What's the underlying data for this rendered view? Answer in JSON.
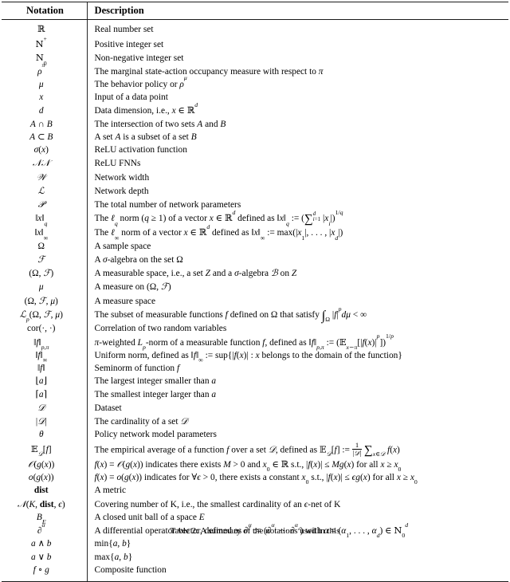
{
  "table": {
    "columns": [
      "Notation",
      "Description"
    ],
    "rows": [
      {
        "notation_html": "<span class=\"bb\">&#8477;</span>",
        "description_html": "Real number set"
      },
      {
        "notation_html": "<span class=\"bb\">N</span><sup>+</sup>",
        "description_html": "Positive integer set"
      },
      {
        "notation_html": "<span class=\"bb\">N</span><sub>0</sub>",
        "description_html": "Non-negative integer set"
      },
      {
        "notation_html": "<span class=\"mi\">&#961;</span><sup><span class=\"mi\">&#960;</span></sup>",
        "description_html": "The marginal state-action occupancy measure with respect to <span class=\"mi\">&#960;</span>"
      },
      {
        "notation_html": "<span class=\"mi\">&#956;</span>",
        "description_html": "The behavior policy or <span class=\"mi\">&#961;</span><sup><span class=\"mi\">&#956;</span></sup>"
      },
      {
        "notation_html": "<span class=\"mi\">x</span>",
        "description_html": "Input of a data point"
      },
      {
        "notation_html": "<span class=\"mi\">d</span>",
        "description_html": "Data dimension, i.e., <span class=\"mi\">x</span> &#8712; <span class=\"bb\">&#8477;</span><sup><span class=\"mi\">d</span></sup>"
      },
      {
        "notation_html": "<span class=\"mi\">A</span> &#8745; <span class=\"mi\">B</span>",
        "description_html": "The intersection of two sets <span class=\"mi\">A</span> and <span class=\"mi\">B</span>"
      },
      {
        "notation_html": "<span class=\"mi\">A</span> &#8834; <span class=\"mi\">B</span>",
        "description_html": "A set <span class=\"mi\">A</span> is a subset of a set <span class=\"mi\">B</span>"
      },
      {
        "notation_html": "<span class=\"mi\">&#963;</span>(<span class=\"mi\">x</span>)",
        "description_html": "ReLU activation function"
      },
      {
        "notation_html": "<span class=\"cal\">&#119977;&#119977;</span>",
        "description_html": "ReLU FNNs"
      },
      {
        "notation_html": "<span class=\"cal\">&#119986;</span>",
        "description_html": "Network width"
      },
      {
        "notation_html": "<span class=\"cal\">&#8466;</span>",
        "description_html": "Network depth"
      },
      {
        "notation_html": "<span class=\"cal\">&#119979;</span>",
        "description_html": "The total number of network parameters"
      },
      {
        "notation_html": "&#8214;<span class=\"mi\">x</span>&#8214;<sub><span class=\"mi\">q</span></sub>",
        "description_html": "The <span class=\"mi\">&#8467;</span><sub><span class=\"mi\">q</span></sub> norm (<span class=\"mi\">q</span> &#8805; 1) of a vector <span class=\"mi\">x</span> &#8712; <span class=\"bb\">&#8477;</span><sup><span class=\"mi\">d</span></sup> defined as &#8214;<span class=\"mi\">x</span>&#8214;<sub><span class=\"mi\">q</span></sub> := (<span class=\"bigop\">&#8721;</span><span class=\"lim\"><span class=\"up\"><span class=\"mi\">d</span></span><span class=\"dn\"><span class=\"mi\">i</span>=1</span></span> |<span class=\"mi\">x</span><sub><span class=\"mi\">i</span></sub>|)<sup>1/<span class=\"mi\">q</span></sup>"
      },
      {
        "notation_html": "&#8214;<span class=\"mi\">x</span>&#8214;<sub>&#8734;</sub>",
        "description_html": "The <span class=\"mi\">&#8467;</span><sub>&#8734;</sub> norm of a vector <span class=\"mi\">x</span> &#8712; <span class=\"bb\">&#8477;</span><sup><span class=\"mi\">d</span></sup> defined as &#8214;<span class=\"mi\">x</span>&#8214;<sub>&#8734;</sub> := max(|<span class=\"mi\">x</span><sub>1</sub>|, . . . , |<span class=\"mi\">x</span><sub><span class=\"mi\">d</span></sub>|)"
      },
      {
        "notation_html": "&#937;",
        "description_html": "A sample space"
      },
      {
        "notation_html": "<span class=\"cal\">&#8497;</span>",
        "description_html": "A <span class=\"mi\">&#963;</span>-algebra on the set &#937;"
      },
      {
        "notation_html": "(&#937;, <span class=\"cal\">&#8497;</span>)",
        "description_html": "A measurable space, i.e., a set <span class=\"mi\">Z</span> and a <span class=\"mi\">&#963;</span>-algebra <span class=\"cal\">&#8492;</span> on <span class=\"mi\">Z</span>"
      },
      {
        "notation_html": "<span class=\"mi\">&#956;</span>",
        "description_html": "A measure on (&#937;, <span class=\"cal\">&#8497;</span>)"
      },
      {
        "notation_html": "(&#937;, <span class=\"cal\">&#8497;</span>, <span class=\"mi\">&#956;</span>)",
        "description_html": "A measure space"
      },
      {
        "notation_html": "<span class=\"cal\">&#8466;</span><sub><span class=\"mi\">p</span></sub>(&#937;, <span class=\"cal\">&#8497;</span>, <span class=\"mi\">&#956;</span>)",
        "description_html": "The subset of measurable functions <span class=\"mi\">f</span> defined on &#937; that satisfy <span class=\"intg\">&#8747;</span><sub>&#937;</sub> |<span class=\"mi\">f</span>|<sup><span class=\"mi\">p</span></sup><span class=\"mi\">d&#956;</span> &lt; &#8734;"
      },
      {
        "notation_html": "cor(&#183;, &#183;)",
        "description_html": "Correlation of two random variables"
      },
      {
        "notation_html": "&#8214;<span class=\"mi\">f</span>&#8214;<sub><span class=\"mi\">p</span>,<span class=\"mi\">&#960;</span></sub>",
        "description_html": "<span class=\"mi\">&#960;</span>-weighted <span class=\"mi\">L</span><sub><span class=\"mi\">p</span></sub>-norm of a measurable function <span class=\"mi\">f</span>, defined as &#8214;<span class=\"mi\">f</span>&#8214;<sub><span class=\"mi\">p</span>,<span class=\"mi\">&#960;</span></sub> := (<span class=\"bb\">&#120124;</span><sub><span class=\"mi\">x</span>&#8764;<span class=\"mi\">&#960;</span></sub>[|<span class=\"mi\">f</span>(<span class=\"mi\">x</span>)|<sup><span class=\"mi\">p</span></sup>])<sup>1/<span class=\"mi\">p</span></sup>"
      },
      {
        "notation_html": "&#8214;<span class=\"mi\">f</span>&#8214;<sub>&#8734;</sub>",
        "description_html": "Uniform norm, defined as &#8214;<span class=\"mi\">f</span>&#8214;<sub>&#8734;</sub> := sup{|<span class=\"mi\">f</span>(<span class=\"mi\">x</span>)| : <span class=\"mi\">x</span> belongs to the domain of the function}"
      },
      {
        "notation_html": "&#8214;<span class=\"mi\">f</span>&#8214;",
        "description_html": "Seminorm of function <span class=\"mi\">f</span>"
      },
      {
        "notation_html": "&#8970;<span class=\"mi\">a</span>&#8971;",
        "description_html": "The largest integer smaller than <span class=\"mi\">a</span>"
      },
      {
        "notation_html": "&#8968;<span class=\"mi\">a</span>&#8969;",
        "description_html": "The smallest integer larger than <span class=\"mi\">a</span>"
      },
      {
        "notation_html": "<span class=\"cal\">&#119967;</span>",
        "description_html": "Dataset"
      },
      {
        "notation_html": "|<span class=\"cal\">&#119967;</span>|",
        "description_html": "The cardinality of a set <span class=\"cal\">&#119967;</span>"
      },
      {
        "notation_html": "<span class=\"mi\">&#952;</span>",
        "description_html": "Policy network model parameters"
      },
      {
        "notation_html": "<span class=\"bb\">&#120124;</span><sub><span class=\"cal\">&#119967;</span></sub>[<span class=\"mi\">f</span>]",
        "description_html": "The empirical average of a function <span class=\"mi\">f</span> over a set <span class=\"cal\">&#119967;</span>, defined as <span class=\"bb\">&#120124;</span><sub><span class=\"cal\">&#119967;</span></sub>[<span class=\"mi\">f</span>] := <span class=\"frac\"><span class=\"num\">1</span><span class=\"den\">|<span class=\"cal\">&#119967;</span>|</span></span> <span class=\"bigop\">&#8721;</span><sub><span class=\"mi\">x</span>&#8712;<span class=\"cal\">&#119967;</span></sub> <span class=\"mi\">f</span>(<span class=\"mi\">x</span>)"
      },
      {
        "notation_html": "<span class=\"cal\">&#119978;</span>(<span class=\"mi\">g</span>(<span class=\"mi\">x</span>))",
        "description_html": "<span class=\"mi\">f</span>(<span class=\"mi\">x</span>) = <span class=\"cal\">&#119978;</span>(<span class=\"mi\">g</span>(<span class=\"mi\">x</span>)) indicates there exists <span class=\"mi\">M</span> &gt; 0 and <span class=\"mi\">x</span><sub>0</sub> &#8712; <span class=\"bb\">&#8477;</span> s.t., |<span class=\"mi\">f</span>(<span class=\"mi\">x</span>)| &#8804; <span class=\"mi\">Mg</span>(<span class=\"mi\">x</span>) for all <span class=\"mi\">x</span> &#8805; <span class=\"mi\">x</span><sub>0</sub>"
      },
      {
        "notation_html": "<span class=\"mi\">o</span>(<span class=\"mi\">g</span>(<span class=\"mi\">x</span>))",
        "description_html": "<span class=\"mi\">f</span>(<span class=\"mi\">x</span>) = <span class=\"mi\">o</span>(<span class=\"mi\">g</span>(<span class=\"mi\">x</span>)) indicates for &#8704;<span class=\"mi\">&#1013;</span> &gt; 0, there exists a constant <span class=\"mi\">x</span><sub>0</sub> s.t., |<span class=\"mi\">f</span>(<span class=\"mi\">x</span>)| &#8804; <span class=\"mi\">&#1013;g</span>(<span class=\"mi\">x</span>) for all <span class=\"mi\">x</span> &#8805; <span class=\"mi\">x</span><sub>0</sub>"
      },
      {
        "notation_html": "<span class=\"bold\">dist</span>",
        "description_html": "A metric"
      },
      {
        "notation_html": "<span class=\"cal\">&#119977;</span>(<span class=\"mi\">K</span>, <span class=\"bold\">dist</span>, <span class=\"mi\">&#1013;</span>)",
        "description_html": "Covering number of K, i.e., the smallest cardinality of an <span class=\"mi\">&#1013;</span>-net of K"
      },
      {
        "notation_html": "<span class=\"mi\">B</span><sub><span class=\"mi\">E</span></sub>",
        "description_html": "A closed unit ball of a space <span class=\"mi\">E</span>"
      },
      {
        "notation_html": "&#8706;<sup><span class=\"mi\">&#945;</span></sup>",
        "description_html": "A differential operator vector, defined as &#8706;<sup><span class=\"mi\">&#945;</span></sup> := (&#8706;<sup><span class=\"mi\">&#945;</span><sub>1</sub></sup> &#183;&#183;&#183; &#8706;<sup><span class=\"mi\">&#945;</span><sub><span class=\"mi\">d</span></sub></sup>) with <span class=\"mi\">&#945;</span> = (<span class=\"mi\">&#945;</span><sub>1</sub>, . . . , <span class=\"mi\">&#945;</span><sub><span class=\"mi\">d</span></sub>) &#8712; <span class=\"bb\">N</span><sub>0</sub><sup><span class=\"mi\">d</span></sup>"
      },
      {
        "notation_html": "<span class=\"mi\">a</span> &#8743; <span class=\"mi\">b</span>",
        "description_html": "min{<span class=\"mi\">a</span>, <span class=\"mi\">b</span>}"
      },
      {
        "notation_html": "<span class=\"mi\">a</span> &#8744; <span class=\"mi\">b</span>",
        "description_html": "max{<span class=\"mi\">a</span>, <span class=\"mi\">b</span>}"
      },
      {
        "notation_html": "<span class=\"mi\">f</span> &#8728; <span class=\"mi\">g</span>",
        "description_html": "Composite function"
      }
    ]
  },
  "caption": {
    "text": "Table 2: A summary of the notations used in this"
  }
}
